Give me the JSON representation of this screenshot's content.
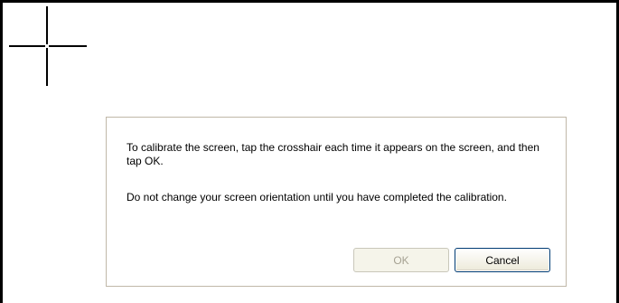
{
  "dialog": {
    "message_1": "To calibrate the screen, tap the crosshair each time it appears on the screen, and then tap OK.",
    "message_2": "Do not change your screen orientation until you have completed the calibration.",
    "ok_label": "OK",
    "ok_enabled": false,
    "cancel_label": "Cancel"
  },
  "icons": {
    "crosshair": "crosshair-icon"
  },
  "colors": {
    "screen_border": "#000000",
    "dialog_border": "#c0b8a8",
    "disabled_text": "#a6a293",
    "focus_border": "#003c74"
  }
}
